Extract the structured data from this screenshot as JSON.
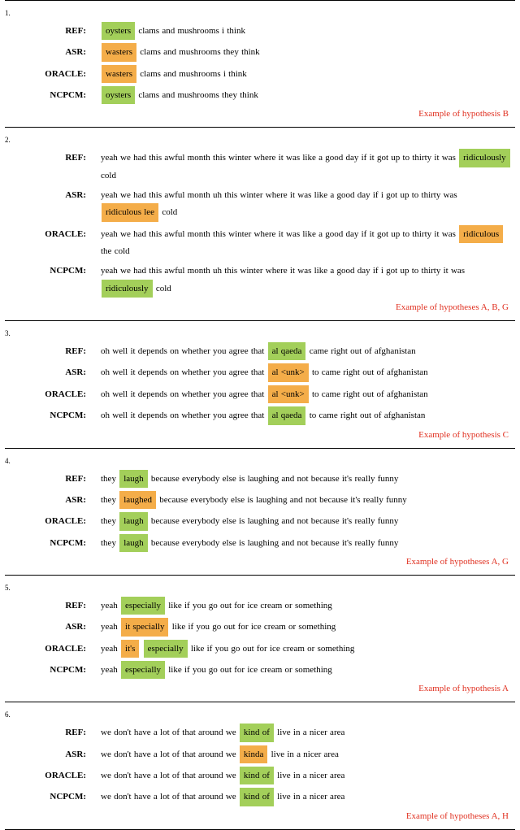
{
  "labels": {
    "ref": "REF:",
    "asr": "ASR:",
    "oracle": "ORACLE:",
    "ncpcm": "NCPCM:"
  },
  "colors": {
    "green": "#a3cf5a",
    "orange": "#f4ad49",
    "caption": "#e03020"
  },
  "examples": [
    {
      "num": "1.",
      "rows": {
        "ref": [
          {
            "t": "oysters",
            "c": "green"
          },
          {
            "t": " clams and mushrooms i think"
          }
        ],
        "asr": [
          {
            "t": "wasters",
            "c": "orange"
          },
          {
            "t": " clams and mushrooms they think"
          }
        ],
        "oracle": [
          {
            "t": "wasters",
            "c": "orange"
          },
          {
            "t": " clams and mushrooms i think"
          }
        ],
        "ncpcm": [
          {
            "t": "oysters",
            "c": "green"
          },
          {
            "t": " clams and mushrooms they think"
          }
        ]
      },
      "caption": "Example of hypothesis B"
    },
    {
      "num": "2.",
      "rows": {
        "ref": [
          {
            "t": "yeah we had this awful month this winter where it was like a good day if it got up to thirty it was "
          },
          {
            "t": "ridiculously",
            "c": "green"
          },
          {
            "t": " cold"
          }
        ],
        "asr": [
          {
            "t": "yeah we had this awful month uh this winter where it was like a good day if i got up to thirty was "
          },
          {
            "t": "ridiculous lee",
            "c": "orange"
          },
          {
            "t": " cold"
          }
        ],
        "oracle": [
          {
            "t": "yeah we had this awful month this winter where it was like a good day if it got up to thirty it was "
          },
          {
            "t": "ridiculous",
            "c": "orange"
          },
          {
            "t": " the cold"
          }
        ],
        "ncpcm": [
          {
            "t": "yeah we had this awful month uh this winter where it was like a good day if i got up to thirty it was "
          },
          {
            "t": "ridiculously",
            "c": "green"
          },
          {
            "t": " cold"
          }
        ]
      },
      "caption": "Example of hypotheses A, B, G"
    },
    {
      "num": "3.",
      "rows": {
        "ref": [
          {
            "t": "oh well it depends on whether you agree that "
          },
          {
            "t": "al qaeda",
            "c": "green"
          },
          {
            "t": " came right out of afghanistan"
          }
        ],
        "asr": [
          {
            "t": "oh well it depends on whether you agree that "
          },
          {
            "t": "al <unk>",
            "c": "orange"
          },
          {
            "t": " to came right out of afghanistan"
          }
        ],
        "oracle": [
          {
            "t": "oh well it depends on whether you agree that "
          },
          {
            "t": "al <unk>",
            "c": "orange"
          },
          {
            "t": " to came right out of afghanistan"
          }
        ],
        "ncpcm": [
          {
            "t": "oh well it depends on whether you agree that "
          },
          {
            "t": "al qaeda",
            "c": "green"
          },
          {
            "t": " to came right out of afghanistan"
          }
        ]
      },
      "caption": "Example of hypothesis C"
    },
    {
      "num": "4.",
      "rows": {
        "ref": [
          {
            "t": "they "
          },
          {
            "t": "laugh",
            "c": "green"
          },
          {
            "t": " because everybody else is laughing and not because it's really funny"
          }
        ],
        "asr": [
          {
            "t": "they "
          },
          {
            "t": "laughed",
            "c": "orange"
          },
          {
            "t": " because everybody else is laughing and not because it's really funny"
          }
        ],
        "oracle": [
          {
            "t": "they "
          },
          {
            "t": "laugh",
            "c": "green"
          },
          {
            "t": " because everybody else is laughing and not because it's really funny"
          }
        ],
        "ncpcm": [
          {
            "t": "they "
          },
          {
            "t": "laugh",
            "c": "green"
          },
          {
            "t": " because everybody else is laughing and not because it's really funny"
          }
        ]
      },
      "caption": "Example of hypotheses A, G"
    },
    {
      "num": "5.",
      "rows": {
        "ref": [
          {
            "t": "yeah "
          },
          {
            "t": "especially",
            "c": "green"
          },
          {
            "t": " like if you go out for ice cream or something"
          }
        ],
        "asr": [
          {
            "t": "yeah "
          },
          {
            "t": "it specially",
            "c": "orange"
          },
          {
            "t": " like if you go out for ice cream or something"
          }
        ],
        "oracle": [
          {
            "t": "yeah "
          },
          {
            "t": "it's",
            "c": "orange"
          },
          {
            "t": " "
          },
          {
            "t": "especially",
            "c": "green"
          },
          {
            "t": " like if you go out for ice cream or something"
          }
        ],
        "ncpcm": [
          {
            "t": "yeah "
          },
          {
            "t": "especially",
            "c": "green"
          },
          {
            "t": " like if you go out for ice cream or something"
          }
        ]
      },
      "caption": "Example of hypothesis A"
    },
    {
      "num": "6.",
      "rows": {
        "ref": [
          {
            "t": "we don't have a lot of that around we "
          },
          {
            "t": "kind of",
            "c": "green"
          },
          {
            "t": " live in a nicer area"
          }
        ],
        "asr": [
          {
            "t": "we don't have a lot of that around we "
          },
          {
            "t": "kinda",
            "c": "orange"
          },
          {
            "t": " live in a nicer area"
          }
        ],
        "oracle": [
          {
            "t": "we don't have a lot of that around we "
          },
          {
            "t": "kind of",
            "c": "green"
          },
          {
            "t": " live in a nicer area"
          }
        ],
        "ncpcm": [
          {
            "t": "we don't have a lot of that around we "
          },
          {
            "t": "kind of",
            "c": "green"
          },
          {
            "t": " live in a nicer area"
          }
        ]
      },
      "caption": "Example of hypotheses A, H"
    }
  ]
}
